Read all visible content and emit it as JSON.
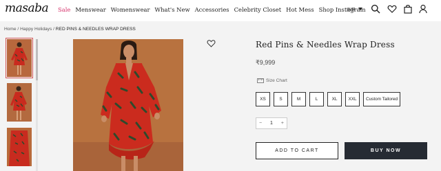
{
  "header": {
    "logo": "masaba",
    "nav": [
      "Sale",
      "Menswear",
      "Womenswear",
      "What's New",
      "Accessories",
      "Celebrity Closet",
      "Hot Mess",
      "Shop Instagram"
    ],
    "currency": "INR",
    "icons": [
      "search-icon",
      "heart-icon",
      "bag-icon",
      "user-icon"
    ]
  },
  "breadcrumb": {
    "home": "Home",
    "sep1": " / ",
    "category": "Happy Holidays",
    "sep2": " / ",
    "current": "RED PINS & NEEDLES WRAP DRESS"
  },
  "product": {
    "title": "Red Pins & Needles Wrap Dress",
    "price": "₹9,999",
    "size_chart_label": "Size Chart",
    "sizes": [
      "XS",
      "S",
      "M",
      "L",
      "XL",
      "XXL",
      "Custom Tailored"
    ],
    "quantity": "1",
    "qty_minus": "−",
    "qty_plus": "+",
    "add_to_cart": "ADD TO CART",
    "buy_now": "BUY NOW"
  },
  "colors": {
    "accent_sale": "#d6336c",
    "buy_button": "#262b33",
    "background_band": "#f3f3f3"
  }
}
